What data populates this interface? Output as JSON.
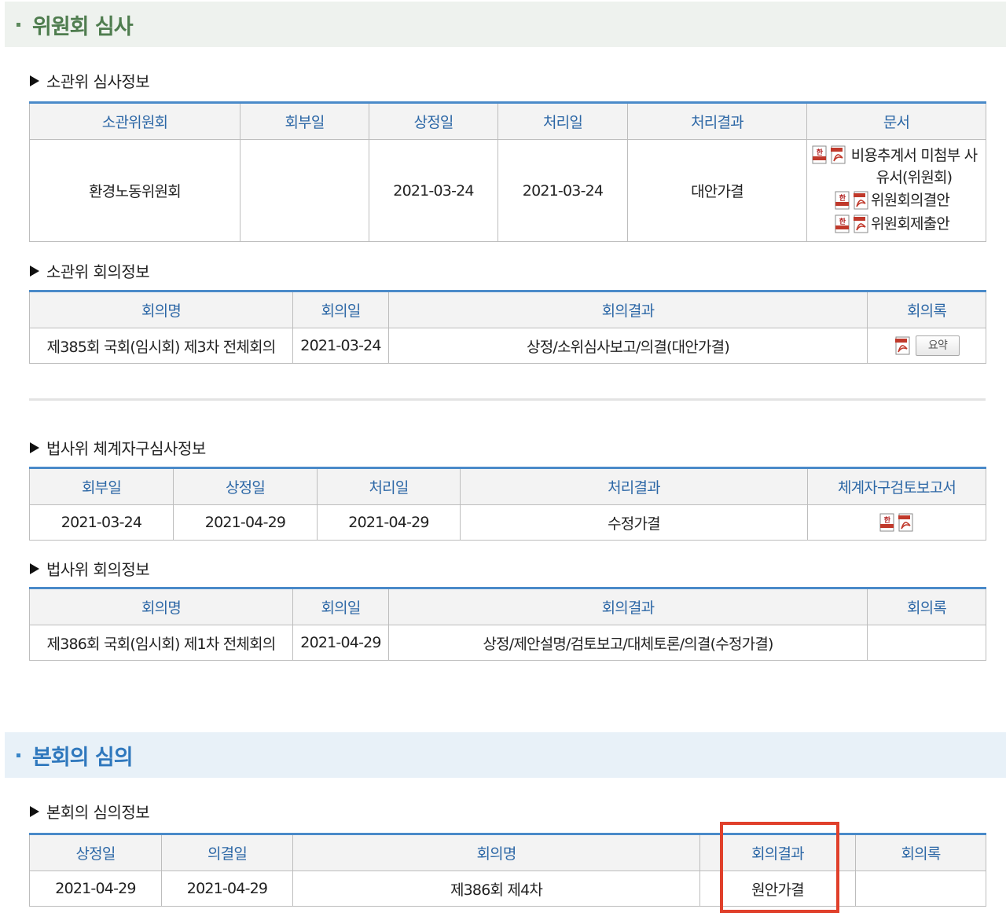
{
  "committee_section": {
    "title": "위원회 심사"
  },
  "plenary_section": {
    "title": "본회의 심의"
  },
  "committee_review": {
    "heading": "소관위 심사정보",
    "columns": [
      "소관위원회",
      "회부일",
      "상정일",
      "처리일",
      "처리결과",
      "문서"
    ],
    "row": {
      "committee": "환경노동위원회",
      "referral_date": "",
      "presentation_date": "2021-03-24",
      "processing_date": "2021-03-24",
      "result": "대안가결",
      "docs": [
        "비용추계서 미첨부 사유서(위원회)",
        "위원회의결안",
        "위원회제출안"
      ]
    }
  },
  "committee_meeting": {
    "heading": "소관위 회의정보",
    "columns": [
      "회의명",
      "회의일",
      "회의결과",
      "회의록"
    ],
    "row": {
      "name": "제385회 국회(임시회) 제3차 전체회의",
      "date": "2021-03-24",
      "result": "상정/소위심사보고/의결(대안가결)",
      "summary_label": "요약"
    }
  },
  "legislation_review": {
    "heading": "법사위 체계자구심사정보",
    "columns": [
      "회부일",
      "상정일",
      "처리일",
      "처리결과",
      "체계자구검토보고서"
    ],
    "row": {
      "referral_date": "2021-03-24",
      "presentation_date": "2021-04-29",
      "processing_date": "2021-04-29",
      "result": "수정가결"
    }
  },
  "legislation_meeting": {
    "heading": "법사위 회의정보",
    "columns": [
      "회의명",
      "회의일",
      "회의결과",
      "회의록"
    ],
    "row": {
      "name": "제386회 국회(임시회) 제1차 전체회의",
      "date": "2021-04-29",
      "result": "상정/제안설명/검토보고/대체토론/의결(수정가결)"
    }
  },
  "plenary": {
    "heading": "본회의 심의정보",
    "columns": [
      "상정일",
      "의결일",
      "회의명",
      "회의결과",
      "회의록"
    ],
    "row": {
      "presentation_date": "2021-04-29",
      "resolution_date": "2021-04-29",
      "meeting_name": "제386회 제4차",
      "result": "원안가결"
    }
  },
  "colors": {
    "section_green": "#4f7d4f",
    "section_blue": "#2f78bd",
    "header_text": "#2c67a6",
    "table_top": "#4a8ac9",
    "highlight": "#e0402b"
  },
  "icons": [
    "hwp-icon",
    "pdf-icon"
  ]
}
